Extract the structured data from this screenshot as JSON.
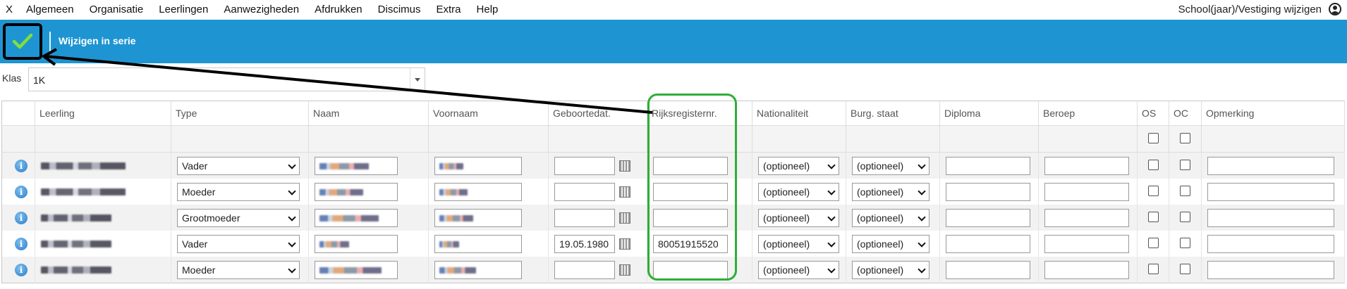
{
  "menu": {
    "items": [
      "X",
      "Algemeen",
      "Organisatie",
      "Leerlingen",
      "Aanwezigheden",
      "Afdrukken",
      "Discimus",
      "Extra",
      "Help"
    ],
    "right_label": "School(jaar)/Vestiging wijzigen"
  },
  "toolbar": {
    "title": "Wijzigen in serie"
  },
  "klas": {
    "label": "Klas",
    "value": "1K"
  },
  "columns": [
    "Leerling",
    "Type",
    "Naam",
    "Voornaam",
    "Geboortedat.",
    "Rijksregisternr.",
    "Nationaliteit",
    "Burg. staat",
    "Diploma",
    "Beroep",
    "OS",
    "OC",
    "Opmerking"
  ],
  "rows": [
    {
      "type": "Vader",
      "geboortedatum": "",
      "rijksregisternr": "",
      "nationaliteit": "(optioneel)",
      "burg_staat": "(optioneel)"
    },
    {
      "type": "Moeder",
      "geboortedatum": "",
      "rijksregisternr": "",
      "nationaliteit": "(optioneel)",
      "burg_staat": "(optioneel)"
    },
    {
      "type": "Grootmoeder",
      "geboortedatum": "",
      "rijksregisternr": "",
      "nationaliteit": "(optioneel)",
      "burg_staat": "(optioneel)"
    },
    {
      "type": "Vader",
      "geboortedatum": "19.05.1980",
      "rijksregisternr": "80051915520",
      "nationaliteit": "(optioneel)",
      "burg_staat": "(optioneel)"
    },
    {
      "type": "Moeder",
      "geboortedatum": "",
      "rijksregisternr": "",
      "nationaliteit": "(optioneel)",
      "burg_staat": "(optioneel)"
    }
  ],
  "colors": {
    "toolbar": "#1e95d2",
    "highlight": "#2eae3a",
    "check": "#7ee03a"
  }
}
